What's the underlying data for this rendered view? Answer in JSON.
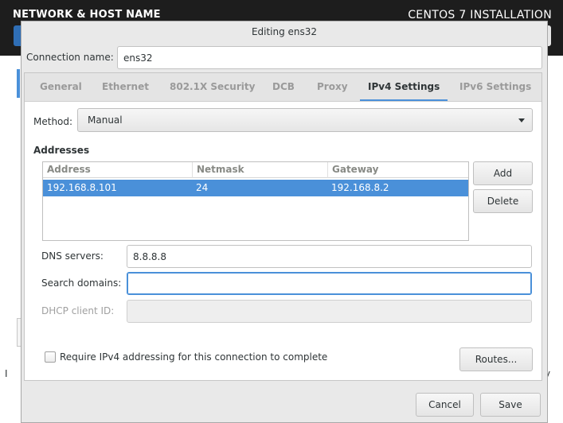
{
  "background": {
    "left_title": "NETWORK & HOST NAME",
    "right_title": "CENTOS 7 INSTALLATION",
    "left_char": "I",
    "right_char": "y"
  },
  "dialog": {
    "title": "Editing ens32",
    "connection_name_label": "Connection name:",
    "connection_name_value": "ens32",
    "tabs": [
      {
        "label": "General"
      },
      {
        "label": "Ethernet"
      },
      {
        "label": "802.1X Security"
      },
      {
        "label": "DCB"
      },
      {
        "label": "Proxy"
      },
      {
        "label": "IPv4 Settings",
        "active": true
      },
      {
        "label": "IPv6 Settings"
      }
    ],
    "ipv4": {
      "method_label": "Method:",
      "method_value": "Manual",
      "addresses_heading": "Addresses",
      "columns": [
        "Address",
        "Netmask",
        "Gateway"
      ],
      "rows": [
        {
          "address": "192.168.8.101",
          "netmask": "24",
          "gateway": "192.168.8.2",
          "selected": true
        }
      ],
      "add_label": "Add",
      "delete_label": "Delete",
      "dns_label": "DNS servers:",
      "dns_value": "8.8.8.8",
      "search_label": "Search domains:",
      "search_value": "",
      "dhcp_label": "DHCP client ID:",
      "dhcp_value": "",
      "require_label": "Require IPv4 addressing for this connection to complete",
      "require_checked": false,
      "routes_label": "Routes..."
    },
    "cancel_label": "Cancel",
    "save_label": "Save"
  },
  "colors": {
    "accent": "#4a90d9",
    "header_bg": "#1d1d1d",
    "done_button": "#2f6eb5",
    "dialog_bg": "#e9e9e9"
  }
}
